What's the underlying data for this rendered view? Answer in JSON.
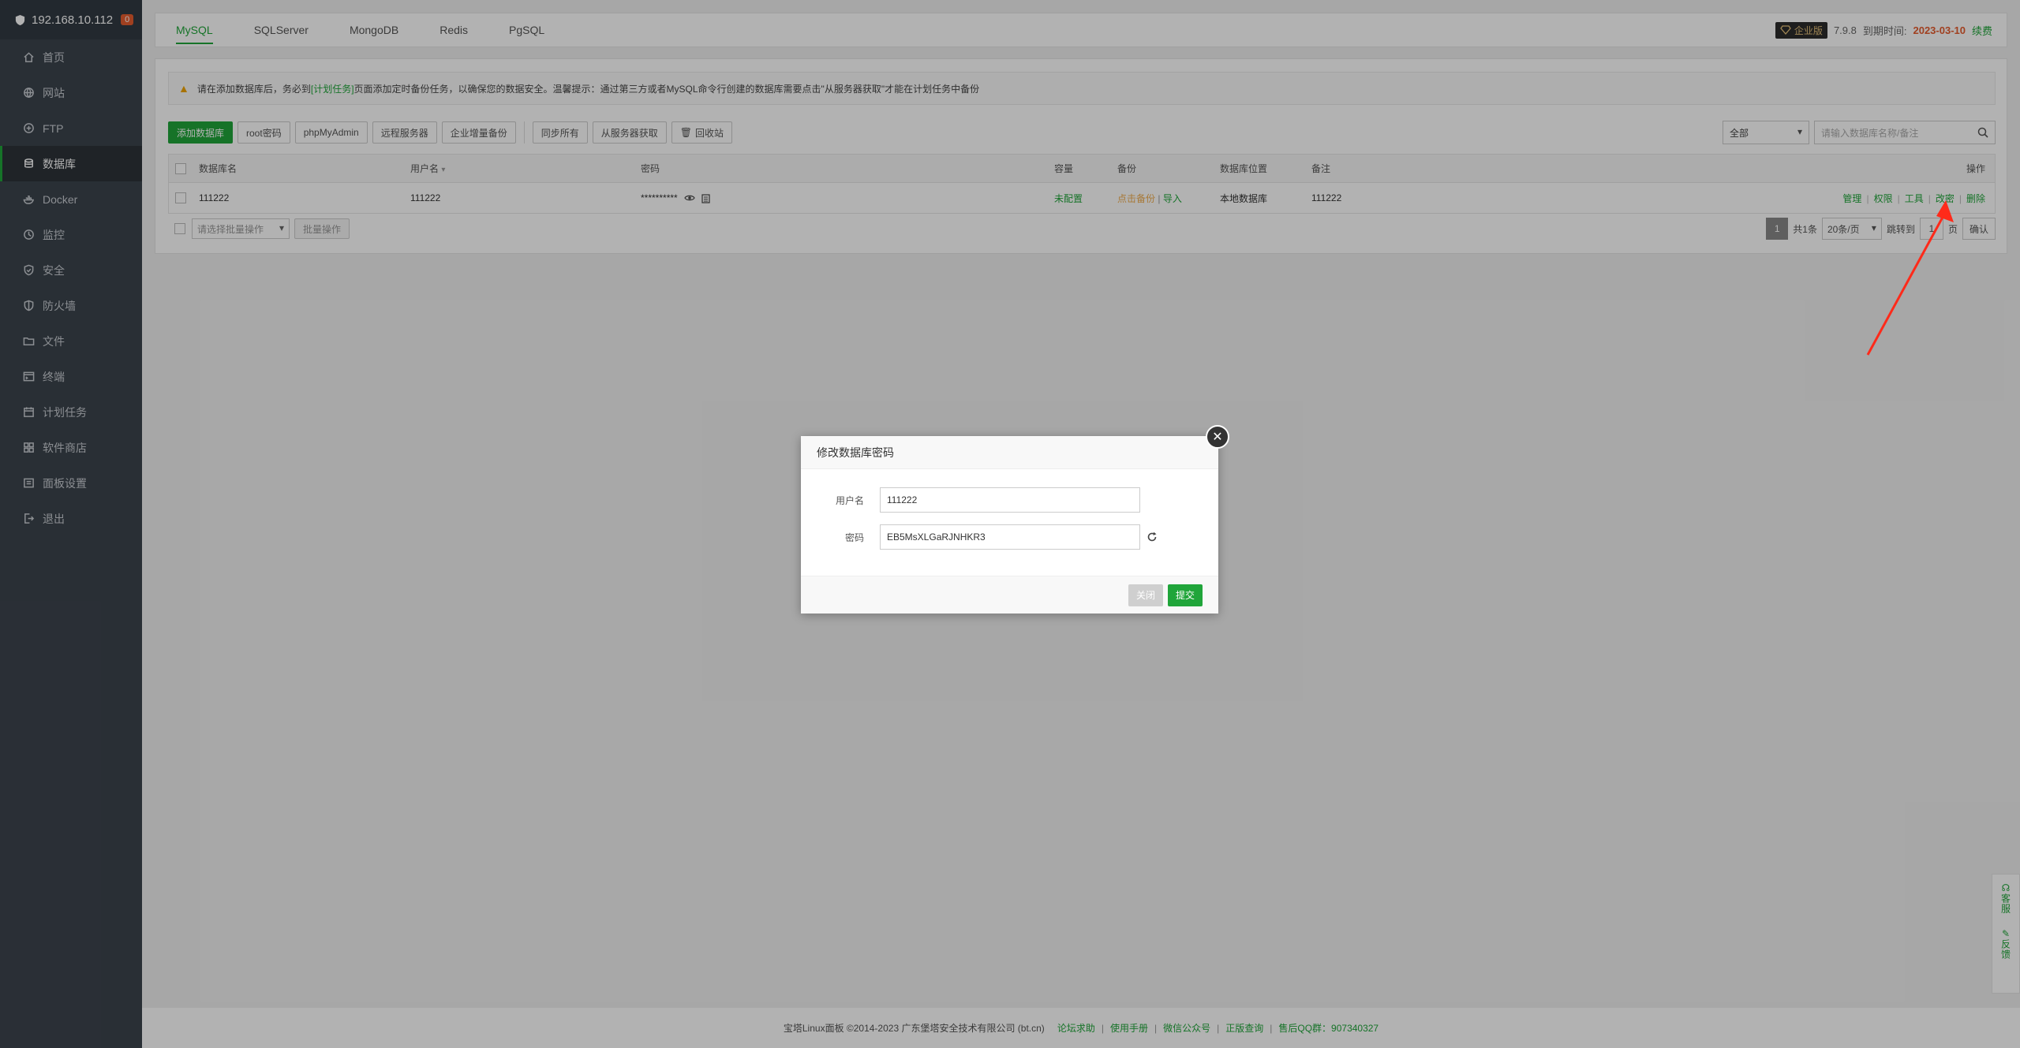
{
  "sidebar": {
    "host": "192.168.10.112",
    "badge": "0",
    "items": [
      {
        "label": "首页",
        "icon": "home-icon"
      },
      {
        "label": "网站",
        "icon": "globe-icon"
      },
      {
        "label": "FTP",
        "icon": "ftp-icon"
      },
      {
        "label": "数据库",
        "icon": "database-icon"
      },
      {
        "label": "Docker",
        "icon": "docker-icon"
      },
      {
        "label": "监控",
        "icon": "monitor-icon"
      },
      {
        "label": "安全",
        "icon": "security-icon"
      },
      {
        "label": "防火墙",
        "icon": "firewall-icon"
      },
      {
        "label": "文件",
        "icon": "folder-icon"
      },
      {
        "label": "终端",
        "icon": "terminal-icon"
      },
      {
        "label": "计划任务",
        "icon": "calendar-icon"
      },
      {
        "label": "软件商店",
        "icon": "apps-icon"
      },
      {
        "label": "面板设置",
        "icon": "settings-icon"
      },
      {
        "label": "退出",
        "icon": "logout-icon"
      }
    ]
  },
  "tabs": [
    "MySQL",
    "SQLServer",
    "MongoDB",
    "Redis",
    "PgSQL"
  ],
  "topinfo": {
    "edition": "企业版",
    "version": "7.9.8",
    "expire_label": "到期时间:",
    "expire_date": "2023-03-10",
    "renew": "续费"
  },
  "notice": {
    "text_before": "请在添加数据库后，务必到",
    "link": "[计划任务]",
    "text_after": "页面添加定时备份任务，以确保您的数据安全。温馨提示：通过第三方或者MySQL命令行创建的数据库需要点击\"从服务器获取\"才能在计划任务中备份"
  },
  "toolbar": {
    "add": "添加数据库",
    "root_pwd": "root密码",
    "phpmyadmin": "phpMyAdmin",
    "remote": "远程服务器",
    "incremental": "企业增量备份",
    "sync_all": "同步所有",
    "from_server": "从服务器获取",
    "recycle": "回收站",
    "filter_value": "全部",
    "search_placeholder": "请输入数据库名称/备注"
  },
  "table": {
    "headers": {
      "name": "数据库名",
      "user": "用户名",
      "password": "密码",
      "size": "容量",
      "backup": "备份",
      "location": "数据库位置",
      "note": "备注",
      "ops": "操作"
    },
    "rows": [
      {
        "name": "111222",
        "user": "111222",
        "password": "**********",
        "size": "未配置",
        "backup_link": "点击备份",
        "import": "导入",
        "location": "本地数据库",
        "note": "111222",
        "ops": [
          "管理",
          "权限",
          "工具",
          "改密",
          "删除"
        ]
      }
    ]
  },
  "footer_bar": {
    "batch_placeholder": "请选择批量操作",
    "batch_btn": "批量操作",
    "page": "1",
    "total": "共1条",
    "per_page": "20条/页",
    "jump_label": "跳转到",
    "jump_value": "1",
    "page_unit": "页",
    "confirm": "确认"
  },
  "footer": {
    "copyright": "宝塔Linux面板 ©2014-2023 广东堡塔安全技术有限公司 (bt.cn)",
    "links": [
      "论坛求助",
      "使用手册",
      "微信公众号",
      "正版查询"
    ],
    "qq": "售后QQ群：907340327"
  },
  "dialog": {
    "title": "修改数据库密码",
    "user_label": "用户名",
    "user_value": "111222",
    "pwd_label": "密码",
    "pwd_value": "EB5MsXLGaRJNHKR3",
    "close_btn": "关闭",
    "submit_btn": "提交"
  },
  "float": {
    "service": "客服",
    "feedback": "反馈"
  },
  "colors": {
    "accent": "#20a53a",
    "sidebar": "#3c444d",
    "expire": "#e65c2e",
    "annotation": "#ff2a1a"
  }
}
